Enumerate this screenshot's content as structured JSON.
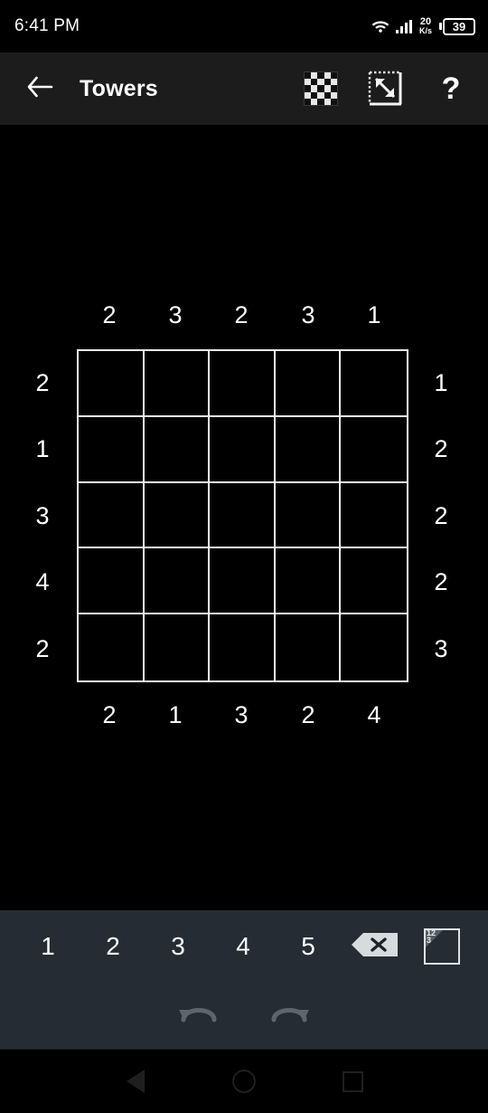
{
  "status_bar": {
    "time": "6:41 PM",
    "net_speed_value": "20",
    "net_speed_unit": "K/s",
    "battery_percent": "39",
    "wifi_icon": "wifi-icon",
    "signal_icon": "signal-bars-icon",
    "battery_icon": "battery-icon"
  },
  "app_bar": {
    "title": "Towers",
    "back_icon": "back-arrow-icon",
    "checkerboard_label": "checkerboard-icon",
    "resize_label": "resize-icon",
    "help_label": "?"
  },
  "chart_data": {
    "type": "table",
    "title": "Towers",
    "size": 5,
    "top_clues": [
      "2",
      "3",
      "2",
      "3",
      "1"
    ],
    "bottom_clues": [
      "2",
      "1",
      "3",
      "2",
      "4"
    ],
    "left_clues": [
      "2",
      "1",
      "3",
      "4",
      "2"
    ],
    "right_clues": [
      "1",
      "2",
      "2",
      "2",
      "3"
    ],
    "cells": [
      [
        "",
        "",
        "",
        "",
        ""
      ],
      [
        "",
        "",
        "",
        "",
        ""
      ],
      [
        "",
        "",
        "",
        "",
        ""
      ],
      [
        "",
        "",
        "",
        "",
        ""
      ],
      [
        "",
        "",
        "",
        "",
        ""
      ]
    ],
    "grid_color": "#f2f2f2",
    "background": "#000000"
  },
  "keypad": {
    "digits": [
      "1",
      "2",
      "3",
      "4",
      "5"
    ],
    "backspace_label": "backspace-icon",
    "marks_label": "pencil-marks-icon",
    "marks_digits_top": "12",
    "marks_digits_bottom": "3",
    "undo_label": "undo-icon",
    "redo_label": "redo-icon",
    "background": "#252c33"
  },
  "nav_bar": {
    "back_label": "nav-back-icon",
    "home_label": "nav-home-icon",
    "recents_label": "nav-recents-icon"
  }
}
